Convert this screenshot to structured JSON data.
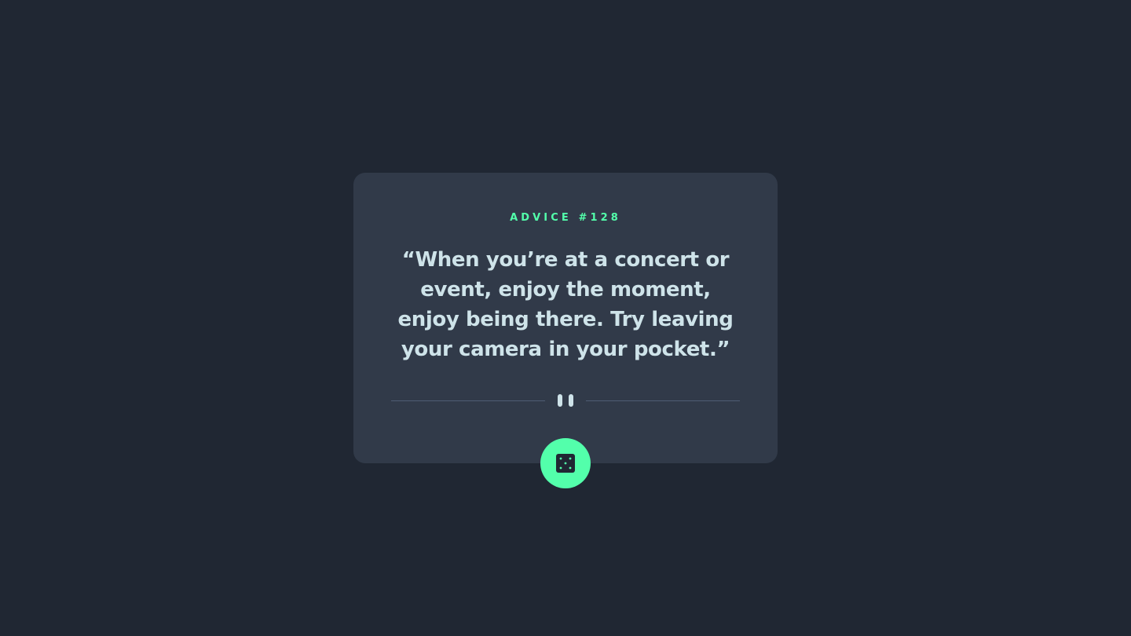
{
  "advice": {
    "id_label": "ADVICE #128",
    "quote": "“When you’re at a concert or event, enjoy the moment, enjoy being there. Try leaving your camera in your pocket.”"
  },
  "controls": {
    "dice_button_icon": "dice-icon",
    "divider_icon": "pause-icon"
  },
  "colors": {
    "background": "#202733",
    "card": "#313a49",
    "accent": "#53ffab",
    "text": "#cee3e9",
    "divider": "#4f5d74"
  }
}
